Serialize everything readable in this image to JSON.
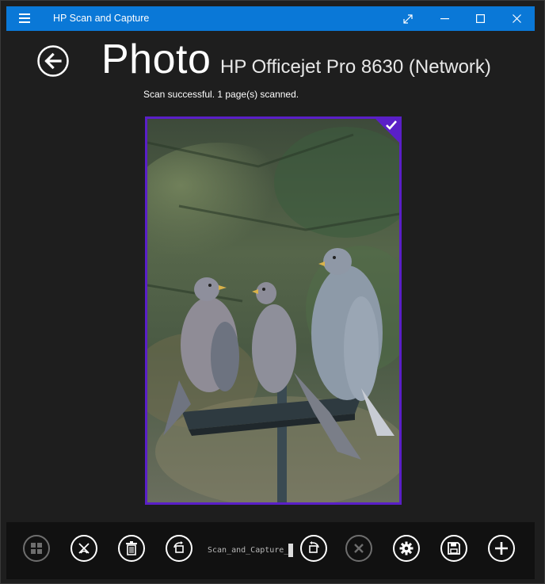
{
  "window": {
    "title": "HP Scan and Capture"
  },
  "header": {
    "mode_title": "Photo",
    "device_name": "HP Officejet Pro 8630 (Network)",
    "status": "Scan successful. 1 page(s) scanned."
  },
  "scan": {
    "selected": true,
    "image_subject": "Three pigeons on a bird feeder"
  },
  "appbar": {
    "filename_value": "Scan_and_Capture_1",
    "buttons": [
      {
        "name": "thumbnails",
        "icon": "grid-icon",
        "enabled": false
      },
      {
        "name": "crop",
        "icon": "crop-icon",
        "enabled": true
      },
      {
        "name": "delete",
        "icon": "trash-icon",
        "enabled": true
      },
      {
        "name": "rotate",
        "icon": "rotate-left-icon",
        "enabled": true
      },
      {
        "name": "rotate-right",
        "icon": "rotate-right-icon",
        "enabled": true
      },
      {
        "name": "cancel",
        "icon": "cancel-icon",
        "enabled": false
      },
      {
        "name": "settings",
        "icon": "gear-icon",
        "enabled": true
      },
      {
        "name": "save",
        "icon": "floppy-disk-icon",
        "enabled": true
      },
      {
        "name": "add",
        "icon": "plus-icon",
        "enabled": true
      }
    ]
  },
  "colors": {
    "titlebar": "#0a78d7",
    "background": "#1e1e1e",
    "selection_border": "#5a1fc7",
    "appbar": "#111111"
  }
}
